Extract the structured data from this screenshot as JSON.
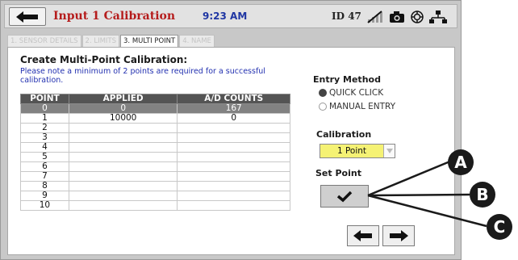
{
  "header": {
    "title": "Input 1 Calibration",
    "time": "9:23 AM",
    "device_id": "ID 47"
  },
  "tabs": [
    {
      "label": "1. SENSOR DETAILS",
      "active": false
    },
    {
      "label": "2. LIMITS",
      "active": false
    },
    {
      "label": "3. MULTI POINT",
      "active": true
    },
    {
      "label": "4. NAME",
      "active": false
    }
  ],
  "main": {
    "heading": "Create Multi-Point Calibration:",
    "note": "Please note a minimum of 2 points are required for a successful calibration.",
    "table": {
      "columns": [
        "POINT",
        "APPLIED",
        "A/D COUNTS"
      ],
      "rows": [
        [
          "0",
          "0",
          "167"
        ],
        [
          "1",
          "10000",
          "0"
        ],
        [
          "2",
          "",
          ""
        ],
        [
          "3",
          "",
          ""
        ],
        [
          "4",
          "",
          ""
        ],
        [
          "5",
          "",
          ""
        ],
        [
          "6",
          "",
          ""
        ],
        [
          "7",
          "",
          ""
        ],
        [
          "8",
          "",
          ""
        ],
        [
          "9",
          "",
          ""
        ],
        [
          "10",
          "",
          ""
        ]
      ],
      "selected_row": 0
    }
  },
  "side": {
    "entry_method_label": "Entry Method",
    "entry_options": [
      {
        "label": "QUICK CLICK",
        "selected": true
      },
      {
        "label": "MANUAL ENTRY",
        "selected": false
      }
    ],
    "calibration_label": "Calibration",
    "calibration_value": "1 Point",
    "set_point_label": "Set Point"
  },
  "callouts": [
    "A",
    "B",
    "C"
  ],
  "colors": {
    "title": "#b51c1c",
    "time": "#1f36a3",
    "note": "#2230b0",
    "dropdown_bg": "#f5f274",
    "header_row": "#545454",
    "selected_row": "#828282"
  },
  "icons": {
    "back": "arrow-left-icon",
    "signal": "no-signal-icon",
    "camera": "camera-icon",
    "settings": "settings-icon",
    "network": "network-icon",
    "check": "checkmark-icon",
    "prev": "arrow-left-icon",
    "next": "arrow-right-icon"
  }
}
